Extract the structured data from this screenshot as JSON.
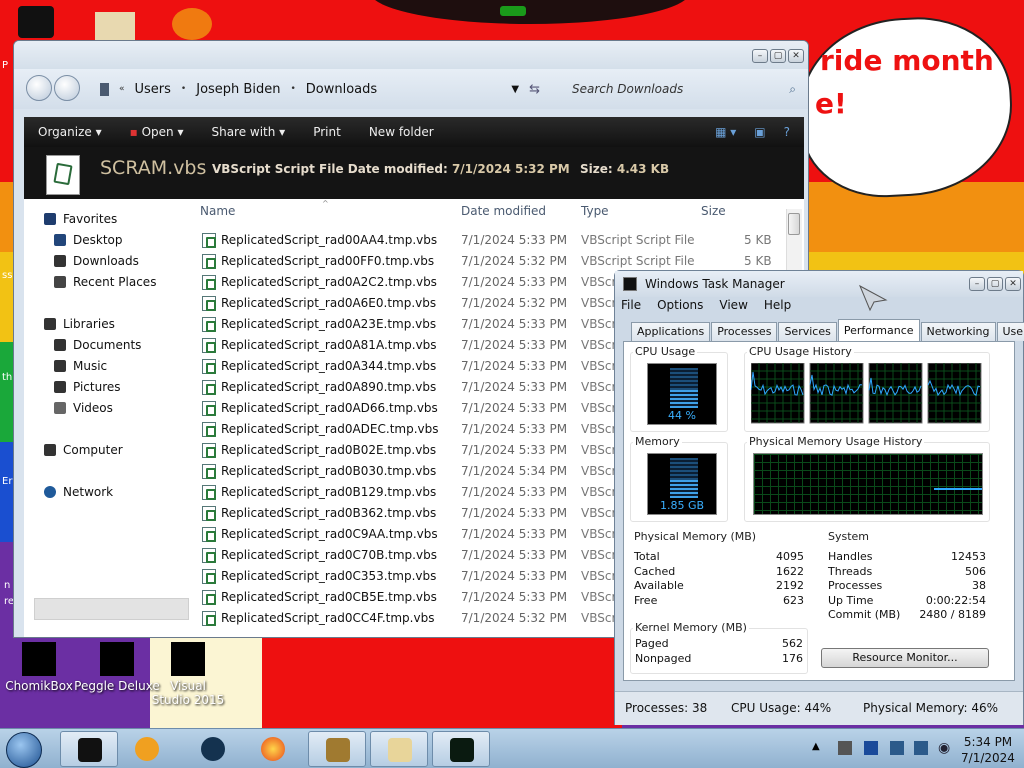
{
  "colors": {
    "wall_red": "#ee1010",
    "wall_yellow": "#f2c214",
    "wall_orange": "#f29010",
    "wall_green": "#1aa83a",
    "wall_blue": "#1a4fd0",
    "wall_purple": "#6b2fa3",
    "wall_cream": "#fbf5d3",
    "toolbar_dark": "#111111",
    "task_chart_line": "#2fa8ff"
  },
  "wallpaper": {
    "bubble_line1": "ride month",
    "bubble_line2": "e!",
    "side_labels": [
      "P",
      "ss",
      "th",
      "Er",
      "n",
      "re"
    ]
  },
  "desktop_icons": [
    {
      "label": "ChomikBox"
    },
    {
      "label": "Peggle Deluxe"
    },
    {
      "label": "Visual Studio 2015"
    }
  ],
  "explorer": {
    "caption_buttons": [
      "–",
      "▢",
      "✕"
    ],
    "breadcrumb": [
      "Users",
      "Joseph Biden",
      "Downloads"
    ],
    "search_placeholder": "Search Downloads",
    "toolbar": {
      "organize": "Organize ▾",
      "open": "Open ▾",
      "share": "Share with ▾",
      "print": "Print",
      "new_folder": "New folder"
    },
    "details": {
      "name": "SCRAM.vbs",
      "type": "VBScript Script File",
      "modified_label": "Date modified:",
      "modified_value": "7/1/2024 5:32 PM",
      "size_label": "Size:",
      "size_value": "4.43 KB"
    },
    "nav": {
      "favorites": "Favorites",
      "desktop": "Desktop",
      "downloads": "Downloads",
      "recent": "Recent Places",
      "libraries": "Libraries",
      "documents": "Documents",
      "music": "Music",
      "pictures": "Pictures",
      "videos": "Videos",
      "computer": "Computer",
      "network": "Network"
    },
    "columns": {
      "name": "Name",
      "date": "Date modified",
      "type": "Type",
      "size": "Size"
    },
    "files": [
      {
        "name": "ReplicatedScript_rad00AA4.tmp.vbs",
        "date": "7/1/2024 5:33 PM",
        "type": "VBScript Script File",
        "size": "5 KB"
      },
      {
        "name": "ReplicatedScript_rad00FF0.tmp.vbs",
        "date": "7/1/2024 5:32 PM",
        "type": "VBScript Script File",
        "size": "5 KB"
      },
      {
        "name": "ReplicatedScript_rad0A2C2.tmp.vbs",
        "date": "7/1/2024 5:33 PM",
        "type": "VBScri",
        "size": ""
      },
      {
        "name": "ReplicatedScript_rad0A6E0.tmp.vbs",
        "date": "7/1/2024 5:32 PM",
        "type": "VBScri",
        "size": ""
      },
      {
        "name": "ReplicatedScript_rad0A23E.tmp.vbs",
        "date": "7/1/2024 5:33 PM",
        "type": "VBScri",
        "size": ""
      },
      {
        "name": "ReplicatedScript_rad0A81A.tmp.vbs",
        "date": "7/1/2024 5:33 PM",
        "type": "VBScri",
        "size": ""
      },
      {
        "name": "ReplicatedScript_rad0A344.tmp.vbs",
        "date": "7/1/2024 5:33 PM",
        "type": "VBScri",
        "size": ""
      },
      {
        "name": "ReplicatedScript_rad0A890.tmp.vbs",
        "date": "7/1/2024 5:33 PM",
        "type": "VBScri",
        "size": ""
      },
      {
        "name": "ReplicatedScript_rad0AD66.tmp.vbs",
        "date": "7/1/2024 5:33 PM",
        "type": "VBScri",
        "size": ""
      },
      {
        "name": "ReplicatedScript_rad0ADEC.tmp.vbs",
        "date": "7/1/2024 5:33 PM",
        "type": "VBScri",
        "size": ""
      },
      {
        "name": "ReplicatedScript_rad0B02E.tmp.vbs",
        "date": "7/1/2024 5:33 PM",
        "type": "VBScri",
        "size": ""
      },
      {
        "name": "ReplicatedScript_rad0B030.tmp.vbs",
        "date": "7/1/2024 5:34 PM",
        "type": "VBScri",
        "size": ""
      },
      {
        "name": "ReplicatedScript_rad0B129.tmp.vbs",
        "date": "7/1/2024 5:33 PM",
        "type": "VBScri",
        "size": ""
      },
      {
        "name": "ReplicatedScript_rad0B362.tmp.vbs",
        "date": "7/1/2024 5:33 PM",
        "type": "VBScri",
        "size": ""
      },
      {
        "name": "ReplicatedScript_rad0C9AA.tmp.vbs",
        "date": "7/1/2024 5:33 PM",
        "type": "VBScri",
        "size": ""
      },
      {
        "name": "ReplicatedScript_rad0C70B.tmp.vbs",
        "date": "7/1/2024 5:33 PM",
        "type": "VBScri",
        "size": ""
      },
      {
        "name": "ReplicatedScript_rad0C353.tmp.vbs",
        "date": "7/1/2024 5:33 PM",
        "type": "VBScri",
        "size": ""
      },
      {
        "name": "ReplicatedScript_rad0CB5E.tmp.vbs",
        "date": "7/1/2024 5:33 PM",
        "type": "VBScri",
        "size": ""
      },
      {
        "name": "ReplicatedScript_rad0CC4F.tmp.vbs",
        "date": "7/1/2024 5:32 PM",
        "type": "VBScri",
        "size": ""
      }
    ]
  },
  "task_manager": {
    "title": "Windows Task Manager",
    "caption_buttons": [
      "–",
      "▢",
      "✕"
    ],
    "menu": [
      "File",
      "Options",
      "View",
      "Help"
    ],
    "tabs": [
      "Applications",
      "Processes",
      "Services",
      "Performance",
      "Networking",
      "Users"
    ],
    "active_tab": "Performance",
    "cpu_usage_label": "CPU Usage",
    "cpu_usage_value": "44 %",
    "cpu_usage_fraction": 0.44,
    "cpu_history_label": "CPU Usage History",
    "memory_label": "Memory",
    "memory_value": "1.85 GB",
    "memory_fraction": 0.46,
    "mem_history_label": "Physical Memory Usage History",
    "physical_memory": {
      "title": "Physical Memory (MB)",
      "rows": [
        {
          "k": "Total",
          "v": "4095"
        },
        {
          "k": "Cached",
          "v": "1622"
        },
        {
          "k": "Available",
          "v": "2192"
        },
        {
          "k": "Free",
          "v": "623"
        }
      ]
    },
    "kernel_memory": {
      "title": "Kernel Memory (MB)",
      "rows": [
        {
          "k": "Paged",
          "v": "562"
        },
        {
          "k": "Nonpaged",
          "v": "176"
        }
      ]
    },
    "system": {
      "title": "System",
      "rows": [
        {
          "k": "Handles",
          "v": "12453"
        },
        {
          "k": "Threads",
          "v": "506"
        },
        {
          "k": "Processes",
          "v": "38"
        },
        {
          "k": "Up Time",
          "v": "0:00:22:54"
        },
        {
          "k": "Commit (MB)",
          "v": "2480 / 8189"
        }
      ]
    },
    "resource_monitor_button": "Resource Monitor...",
    "status": {
      "processes": "Processes: 38",
      "cpu": "CPU Usage: 44%",
      "memory": "Physical Memory: 46%"
    }
  },
  "taskbar": {
    "time": "5:34 PM",
    "date": "7/1/2024",
    "buttons": [
      "terminal-app",
      "media-player",
      "globe-browser",
      "firefox",
      "chomikbox",
      "explorer",
      "task-manager"
    ]
  }
}
